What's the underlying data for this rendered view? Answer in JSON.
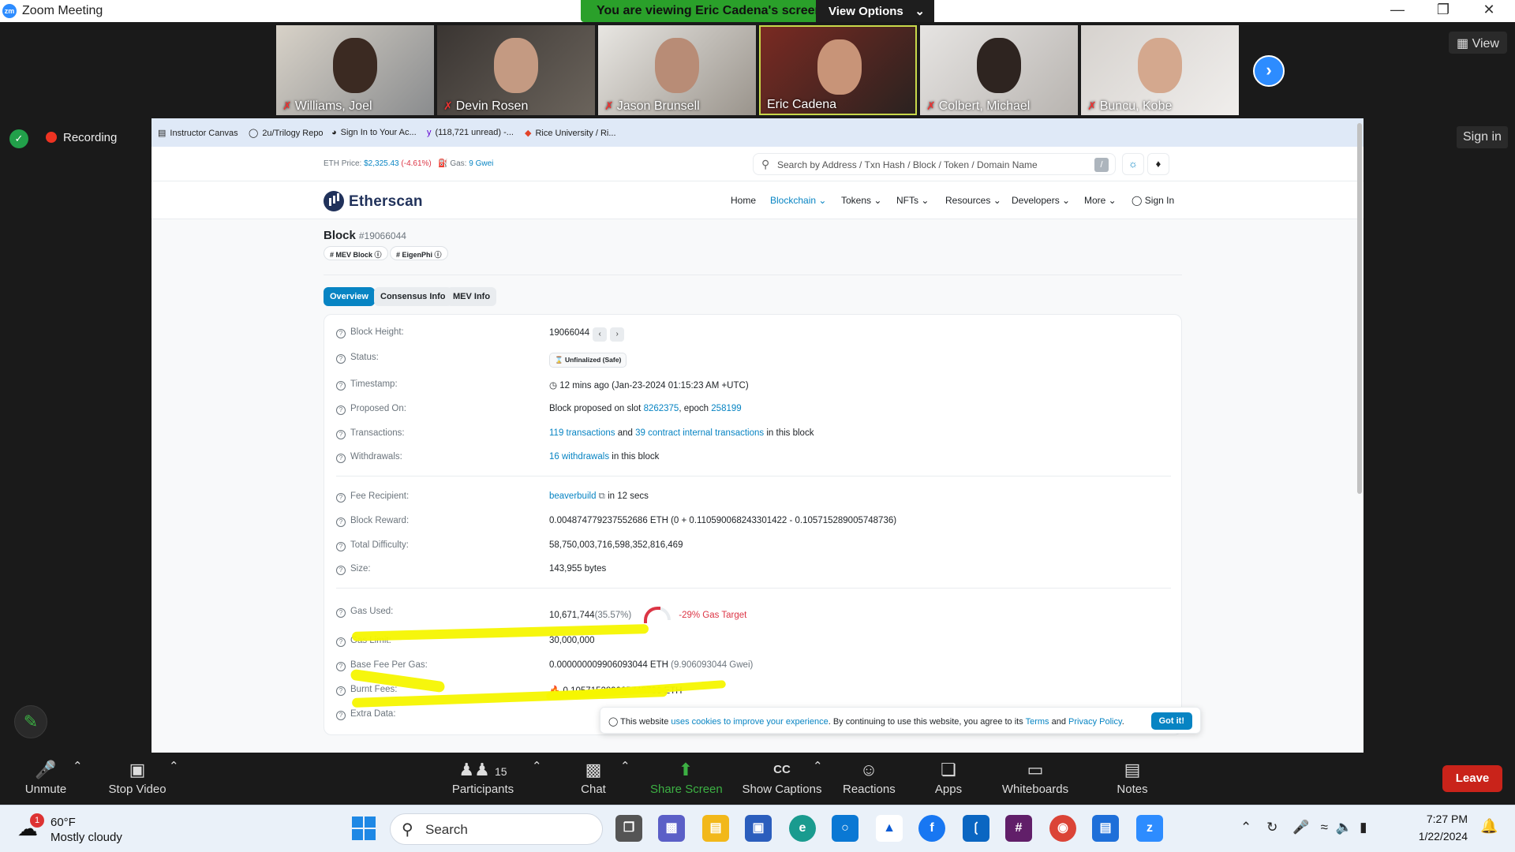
{
  "titlebar": {
    "title": "Zoom Meeting",
    "logo": "zm"
  },
  "share_banner": {
    "text": "You are viewing Eric Cadena's screen",
    "options": "View Options"
  },
  "participants_gallery": [
    {
      "name": "Williams, Joel",
      "muted": true
    },
    {
      "name": "Devin Rosen",
      "muted": true
    },
    {
      "name": "Jason Brunsell",
      "muted": true
    },
    {
      "name": "Eric Cadena",
      "muted": false
    },
    {
      "name": "Colbert, Michael",
      "muted": true
    },
    {
      "name": "Buncu, Kobe",
      "muted": true
    }
  ],
  "view_button": "View",
  "recording_label": "Recording",
  "zoom_signin": "Sign in",
  "bookmarks": [
    "Instructor Canvas",
    "2u/Trilogy Repo",
    "Sign In to Your Ac...",
    "(118,721 unread) -...",
    "Rice University / Ri..."
  ],
  "etherscan": {
    "eth_price_label": "ETH Price:",
    "eth_price": "$2,325.43",
    "eth_change": "(-4.61%)",
    "gas_label": "Gas:",
    "gas_value": "9 Gwei",
    "search_placeholder": "Search by Address / Txn Hash / Block / Token / Domain Name",
    "search_shortcut": "/",
    "logo_text": "Etherscan",
    "nav": [
      "Home",
      "Blockchain",
      "Tokens",
      "NFTs",
      "Resources",
      "Developers",
      "More",
      "Sign In"
    ],
    "block_title": "Block",
    "block_number": "#19066044",
    "badges": [
      "# MEV Block",
      "# EigenPhi"
    ],
    "tabs": [
      "Overview",
      "Consensus Info",
      "MEV Info"
    ],
    "fields": {
      "block_height": {
        "label": "Block Height:",
        "value": "19066044"
      },
      "status": {
        "label": "Status:",
        "value": "Unfinalized (Safe)"
      },
      "timestamp": {
        "label": "Timestamp:",
        "value": "12 mins ago (Jan-23-2024 01:15:23 AM +UTC)"
      },
      "proposed_on": {
        "label": "Proposed On:",
        "prefix": "Block proposed on slot",
        "slot": "8262375",
        "mid": ", epoch",
        "epoch": "258199"
      },
      "transactions": {
        "label": "Transactions:",
        "txns": "119 transactions",
        "and": "and",
        "internal": "39 contract internal transactions",
        "suffix": "in this block"
      },
      "withdrawals": {
        "label": "Withdrawals:",
        "link": "16 withdrawals",
        "suffix": "in this block"
      },
      "fee_recipient": {
        "label": "Fee Recipient:",
        "value": "beaverbuild",
        "suffix": "in 12 secs"
      },
      "block_reward": {
        "label": "Block Reward:",
        "value": "0.004874779237552686 ETH (0 + 0.110590068243301422 - 0.105715289005748736)"
      },
      "total_difficulty": {
        "label": "Total Difficulty:",
        "value": "58,750,003,716,598,352,816,469"
      },
      "size": {
        "label": "Size:",
        "value": "143,955 bytes"
      },
      "gas_used": {
        "label": "Gas Used:",
        "value": "10,671,744",
        "pct": "(35.57%)",
        "target": "-29% Gas Target"
      },
      "gas_limit": {
        "label": "Gas Limit:",
        "value": "30,000,000"
      },
      "base_fee": {
        "label": "Base Fee Per Gas:",
        "value": "0.000000009906093044 ETH",
        "gwei": "(9.906093044 Gwei)"
      },
      "burnt_fees": {
        "label": "Burnt Fees:",
        "value": "0.105715289005748736 ETH"
      },
      "extra_data": {
        "label": "Extra Data:"
      }
    },
    "cookie": {
      "pre": "This website",
      "link": "uses cookies to improve your experience",
      "mid": ". By continuing to use this website, you agree to its",
      "terms": "Terms",
      "and": "and",
      "privacy": "Privacy Policy",
      "end": ".",
      "button": "Got it!"
    }
  },
  "toolbar": {
    "unmute": "Unmute",
    "stop_video": "Stop Video",
    "participants": "Participants",
    "participants_count": "15",
    "chat": "Chat",
    "share_screen": "Share Screen",
    "show_captions": "Show Captions",
    "reactions": "Reactions",
    "apps": "Apps",
    "whiteboards": "Whiteboards",
    "notes": "Notes",
    "leave": "Leave"
  },
  "taskbar": {
    "weather_temp": "60°F",
    "weather_cond": "Mostly cloudy",
    "weather_alert": "1",
    "search": "Search",
    "time": "7:27 PM",
    "date": "1/22/2024"
  },
  "colors": {
    "zoom_blue": "#2d8cff",
    "etherscan_blue": "#0784c3",
    "leave_red": "#c9231a",
    "highlight": "#f5f500",
    "share_green": "#2aa02a"
  }
}
